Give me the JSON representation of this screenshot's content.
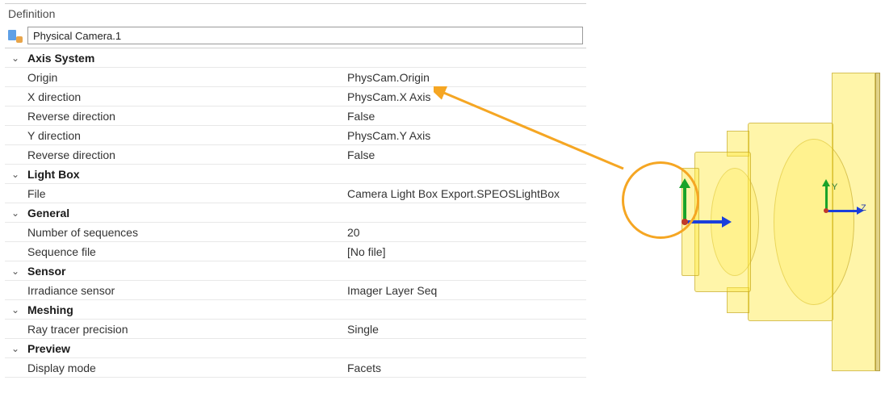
{
  "panel": {
    "title": "Definition",
    "name_value": "Physical Camera.1"
  },
  "groups": {
    "axis_system": {
      "label": "Axis System",
      "props": {
        "origin": {
          "label": "Origin",
          "value": "PhysCam.Origin"
        },
        "x_direction": {
          "label": "X direction",
          "value": "PhysCam.X Axis"
        },
        "reverse_x": {
          "label": "Reverse direction",
          "value": "False"
        },
        "y_direction": {
          "label": "Y direction",
          "value": "PhysCam.Y Axis"
        },
        "reverse_y": {
          "label": "Reverse direction",
          "value": "False"
        }
      }
    },
    "light_box": {
      "label": "Light Box",
      "props": {
        "file": {
          "label": "File",
          "value": "Camera Light Box Export.SPEOSLightBox"
        }
      }
    },
    "general": {
      "label": "General",
      "props": {
        "sequences": {
          "label": "Number of sequences",
          "value": "20"
        },
        "sequence_file": {
          "label": "Sequence file",
          "value": "[No file]"
        }
      }
    },
    "sensor": {
      "label": "Sensor",
      "props": {
        "irradiance": {
          "label": "Irradiance sensor",
          "value": "Imager Layer Seq"
        }
      }
    },
    "meshing": {
      "label": "Meshing",
      "props": {
        "precision": {
          "label": "Ray tracer precision",
          "value": "Single"
        }
      }
    },
    "preview": {
      "label": "Preview",
      "props": {
        "display_mode": {
          "label": "Display mode",
          "value": "Facets"
        }
      }
    }
  },
  "viewport": {
    "axis_labels": {
      "y": "Y",
      "z": "Z"
    }
  },
  "expander_glyph": "⌄"
}
